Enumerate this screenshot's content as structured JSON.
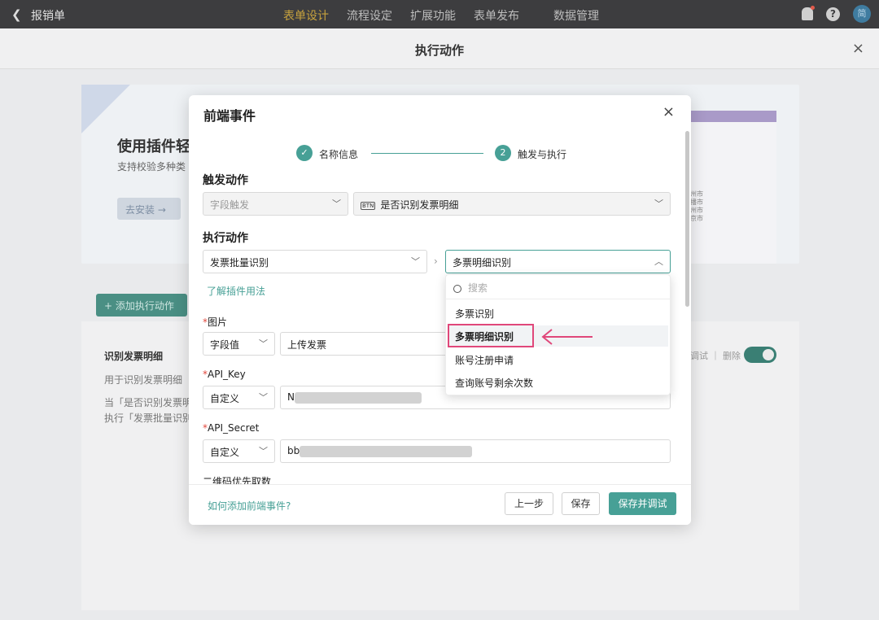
{
  "topbar": {
    "back_icon": "chevron-left",
    "app_name": "报销单",
    "nav": [
      "表单设计",
      "流程设定",
      "扩展功能",
      "表单发布",
      "数据管理"
    ],
    "active_nav": "表单设计",
    "avatar_text": "简"
  },
  "subpage": {
    "title": "执行动作",
    "close": "×"
  },
  "background": {
    "banner_title": "使用插件轻",
    "banner_sub": "支持校验多种类",
    "install_label": "去安装 →",
    "shot_cities": [
      "州市",
      "播市",
      "州市",
      "京市"
    ],
    "add_action_label": "+ 添加执行动作",
    "item_title": "识别发票明细",
    "item_desc": "用于识别发票明细",
    "item_cond1": "当「是否识别发票明",
    "item_cond2": "执行「发票批量识别",
    "ops_text": "调试 ｜ 删除"
  },
  "modal": {
    "title": "前端事件",
    "close": "×",
    "steps": [
      {
        "label": "名称信息",
        "marker": "✓"
      },
      {
        "label": "触发与执行",
        "marker": "2"
      }
    ],
    "trigger_section": "触发动作",
    "trigger_type": "字段触发",
    "trigger_field_icon": "BTN",
    "trigger_field": "是否识别发票明细",
    "exec_section": "执行动作",
    "exec_plugin": "发票批量识别",
    "exec_method": "多票明细识别",
    "learn_link": "了解插件用法",
    "image_label": "图片",
    "image_source": "字段值",
    "image_value": "上传发票",
    "apikey_label": "API_Key",
    "apikey_source": "自定义",
    "apikey_value": "N",
    "apisecret_label": "API_Secret",
    "apisecret_source": "自定义",
    "apisecret_value": "bb",
    "qr_label": "二维码优先取数",
    "footer_help": "如何添加前端事件?",
    "prev_button": "上一步",
    "save_button": "保存",
    "save_debug_button": "保存并调试"
  },
  "dropdown": {
    "search_placeholder": "搜索",
    "options": [
      "多票识别",
      "多票明细识别",
      "账号注册申请",
      "查询账号剩余次数"
    ],
    "selected": "多票明细识别"
  },
  "colors": {
    "accent": "#47a096",
    "highlight": "#e0477a",
    "topbar": "#3d3d3f",
    "active_nav": "#c7a23e"
  }
}
